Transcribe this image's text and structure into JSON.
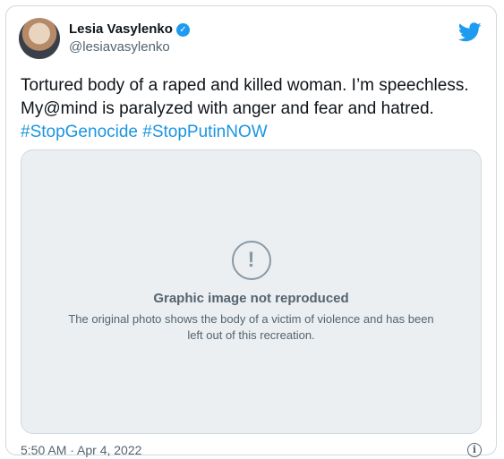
{
  "author": {
    "display_name": "Lesia Vasylenko",
    "handle": "@lesiavasylenko",
    "verified_icon": "verified-badge-icon",
    "verified_mark": "✓"
  },
  "brand_icon": "twitter-bird-icon",
  "tweet": {
    "text": "Tortured body of a raped and killed woman. I’m speechless. My@mind is paralyzed with anger and fear and hatred. ",
    "hashtags": [
      "#StopGenocide",
      "#StopPutinNOW"
    ]
  },
  "footer": {
    "timestamp": "5:50 AM · Apr 4, 2022",
    "info_icon": "info-icon",
    "info_glyph": "i"
  },
  "colors": {
    "link": "#1b95e0",
    "verified": "#1d9bf0",
    "brand": "#1d9bf0",
    "secondary_text": "#536471",
    "border": "#cfd9de"
  }
}
